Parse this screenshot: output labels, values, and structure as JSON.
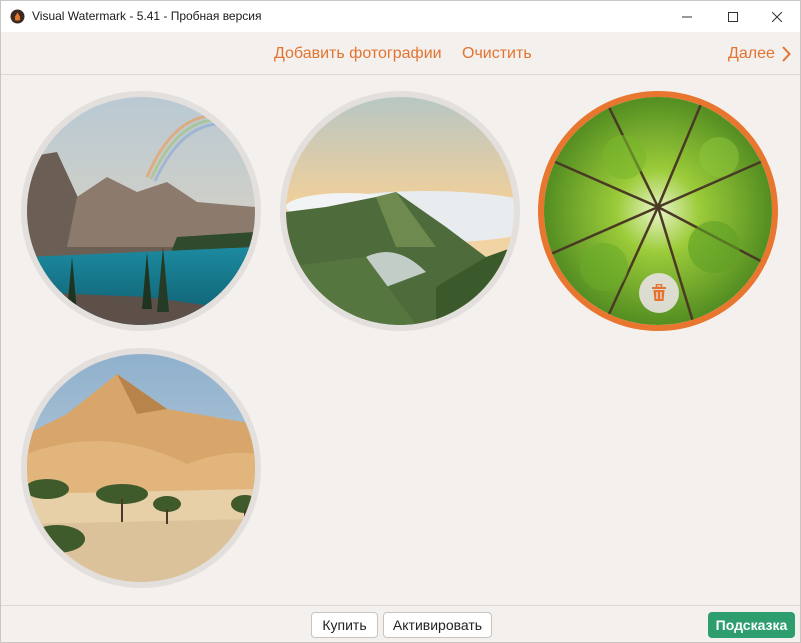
{
  "window": {
    "title": "Visual Watermark - 5.41 - Пробная версия"
  },
  "toolbar": {
    "add_photos": "Добавить фотографии",
    "clear": "Очистить",
    "next": "Далее"
  },
  "gallery": {
    "photos": [
      {
        "subject": "mountain lake with rainbow",
        "selected": false
      },
      {
        "subject": "green hills above clouds",
        "selected": false
      },
      {
        "subject": "forest canopy from below",
        "selected": true
      },
      {
        "subject": "desert sand dunes with acacia trees",
        "selected": false
      }
    ],
    "delete_icon": "trash-icon"
  },
  "footer": {
    "buy": "Купить",
    "activate": "Активировать",
    "hint": "Подсказка"
  },
  "colors": {
    "accent": "#e27430",
    "hint_button": "#2e9e6f",
    "background": "#f3f0ee"
  }
}
